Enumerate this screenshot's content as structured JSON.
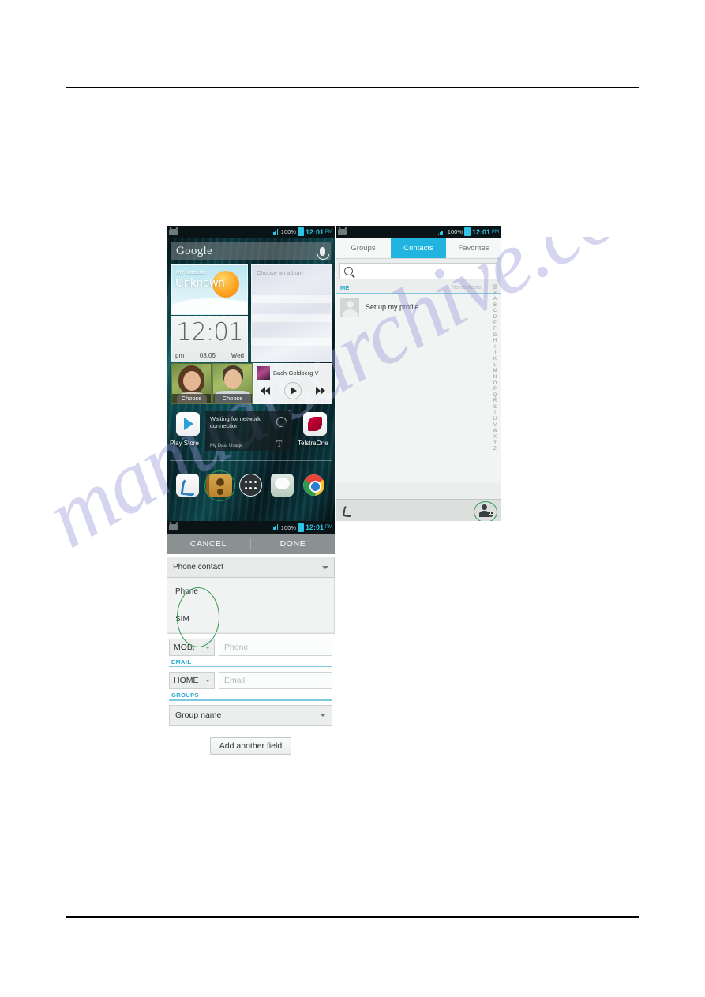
{
  "watermark": {
    "text": "manualsarchive.com"
  },
  "home_screen": {
    "status_bar": {
      "battery_percent": "100%",
      "time": "12:01",
      "meridiem": "PM"
    },
    "search_widget": {
      "brand": "Google",
      "mic_icon": "microphone-icon"
    },
    "weather_widget": {
      "location_label": "My location",
      "condition": "Unknown"
    },
    "clock_widget": {
      "time": "12:01",
      "meridiem": "pm",
      "date": "08.05",
      "weekday": "Wed"
    },
    "album_widget": {
      "label": "Choose an album"
    },
    "photo_widgets": [
      {
        "label": "Choose"
      },
      {
        "label": "Choose"
      }
    ],
    "music_widget": {
      "track": "Bach-Goldberg V",
      "previous_icon": "previous-track-icon",
      "play_icon": "play-icon",
      "next_icon": "next-track-icon"
    },
    "data_widget": {
      "message": "Waiting for network connection",
      "label": "My Data Usage",
      "refresh_icon": "refresh-icon"
    },
    "apps": [
      {
        "label": "Play Store",
        "icon": "play-store-icon"
      },
      {
        "label": "TelstraOne",
        "icon": "telstraone-icon"
      }
    ],
    "dock": [
      {
        "name": "phone",
        "icon": "phone-icon",
        "highlighted": false
      },
      {
        "name": "contacts",
        "icon": "contacts-book-icon",
        "highlighted": true
      },
      {
        "name": "app-drawer",
        "icon": "app-drawer-icon",
        "highlighted": false
      },
      {
        "name": "messaging",
        "icon": "messaging-icon",
        "highlighted": false
      },
      {
        "name": "browser",
        "icon": "chrome-icon",
        "highlighted": false
      }
    ]
  },
  "contacts_screen": {
    "status_bar": {
      "battery_percent": "100%",
      "time": "12:01",
      "meridiem": "PM"
    },
    "tabs": [
      {
        "label": "Groups",
        "active": false
      },
      {
        "label": "Contacts",
        "active": true
      },
      {
        "label": "Favorites",
        "active": false
      }
    ],
    "search": {
      "placeholder": "",
      "icon": "search-icon"
    },
    "me_header": {
      "label": "ME",
      "count_text": "No contacts."
    },
    "me_row": {
      "name": "Set up my profile",
      "avatar": "default-avatar-icon"
    },
    "alpha_index": [
      "@",
      "#",
      "A",
      "B",
      "C",
      "D",
      "E",
      "F",
      "G",
      "H",
      "I",
      "J",
      "K",
      "L",
      "M",
      "N",
      "O",
      "P",
      "Q",
      "R",
      "S",
      "T",
      "U",
      "V",
      "W",
      "X",
      "Y",
      "Z"
    ],
    "bottom_bar": {
      "dial_icon": "phone-icon",
      "add_contact_icon": "add-contact-icon",
      "add_contact_highlighted": true
    }
  },
  "new_contact_form": {
    "status_bar": {
      "battery_percent": "100%",
      "time": "12:01",
      "meridiem": "PM"
    },
    "action_bar": {
      "cancel_label": "CANCEL",
      "done_label": "DONE"
    },
    "account_selector": {
      "value": "Phone contact"
    },
    "account_options": [
      {
        "label": "Phone"
      },
      {
        "label": "SIM"
      }
    ],
    "account_options_highlighted": true,
    "phone_field": {
      "type_label": "MOB.",
      "placeholder": "Phone"
    },
    "email_section": {
      "title": "EMAIL",
      "type_label": "HOME",
      "placeholder": "Email"
    },
    "groups_section": {
      "title": "GROUPS",
      "value": "Group name"
    },
    "add_field_button": {
      "label": "Add another field"
    }
  },
  "colors": {
    "accent_blue": "#21b4de",
    "label_blue": "#2aa6cf",
    "highlight_green": "#2e9b4e"
  }
}
